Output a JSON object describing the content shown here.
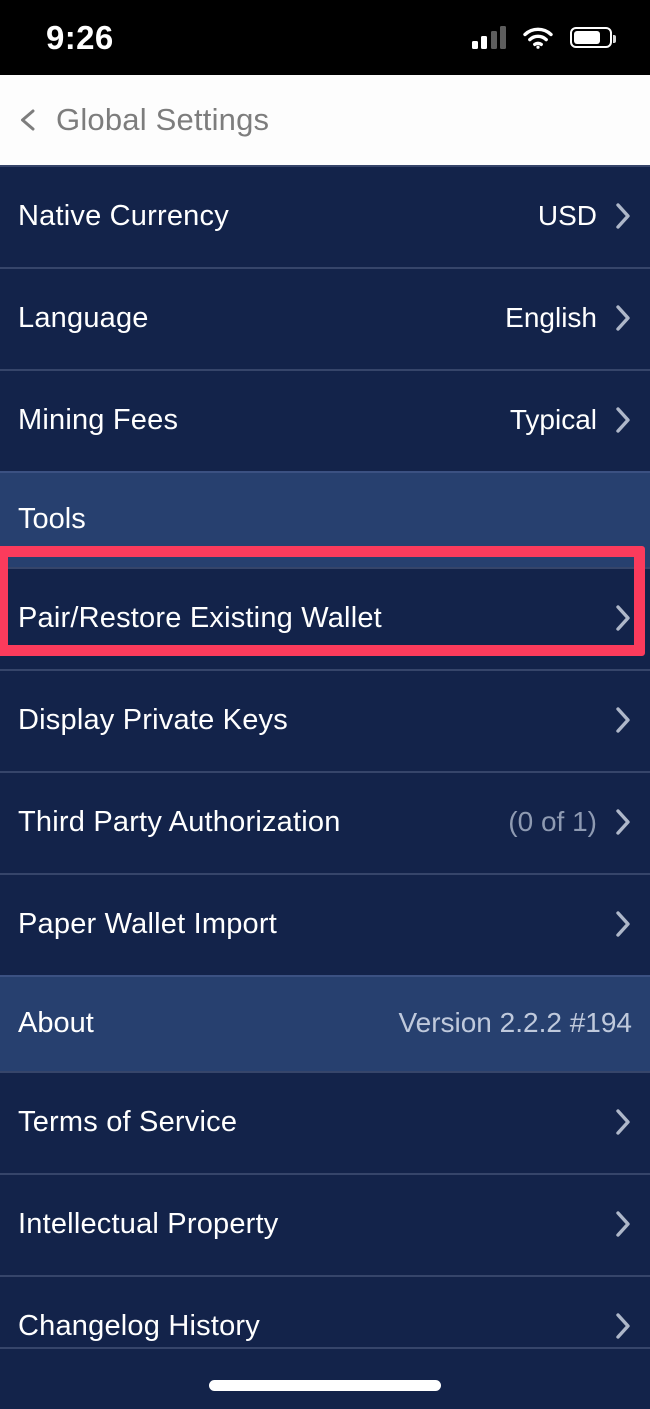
{
  "status_bar": {
    "time": "9:26",
    "cellular_icon": "cellular-signal-icon",
    "wifi_icon": "wifi-icon",
    "battery_icon": "battery-icon",
    "battery_level": 68
  },
  "nav": {
    "back_icon": "chevron-left-icon",
    "title": "Global Settings"
  },
  "colors": {
    "background": "#13234a",
    "section_header": "#27406f",
    "divider": "#36456a",
    "highlight": "#fb3b5c",
    "text_primary": "#ffffff",
    "text_dim": "#8e9ab2",
    "chevron": "#aeb7c9"
  },
  "rows": [
    {
      "label": "Native Currency",
      "value": "USD",
      "value_dim": false,
      "chevron": true,
      "type": "row"
    },
    {
      "label": "Language",
      "value": "English",
      "value_dim": false,
      "chevron": true,
      "type": "row"
    },
    {
      "label": "Mining Fees",
      "value": "Typical",
      "value_dim": false,
      "chevron": true,
      "type": "row"
    },
    {
      "label": "Tools",
      "value": "",
      "value_dim": false,
      "chevron": false,
      "type": "section"
    },
    {
      "label": "Pair/Restore Existing Wallet",
      "value": "",
      "value_dim": false,
      "chevron": true,
      "type": "row",
      "highlighted": true
    },
    {
      "label": "Display Private Keys",
      "value": "",
      "value_dim": false,
      "chevron": true,
      "type": "row"
    },
    {
      "label": "Third Party Authorization",
      "value": "(0 of 1)",
      "value_dim": true,
      "chevron": true,
      "type": "row"
    },
    {
      "label": "Paper Wallet Import",
      "value": "",
      "value_dim": false,
      "chevron": true,
      "type": "row"
    },
    {
      "label": "About",
      "value": "Version 2.2.2 #194",
      "value_dim": false,
      "chevron": false,
      "type": "section"
    },
    {
      "label": "Terms of Service",
      "value": "",
      "value_dim": false,
      "chevron": true,
      "type": "row"
    },
    {
      "label": "Intellectual Property",
      "value": "",
      "value_dim": false,
      "chevron": true,
      "type": "row"
    },
    {
      "label": "Changelog History",
      "value": "",
      "value_dim": false,
      "chevron": true,
      "type": "row"
    }
  ],
  "home_indicator": "home-indicator-bar"
}
